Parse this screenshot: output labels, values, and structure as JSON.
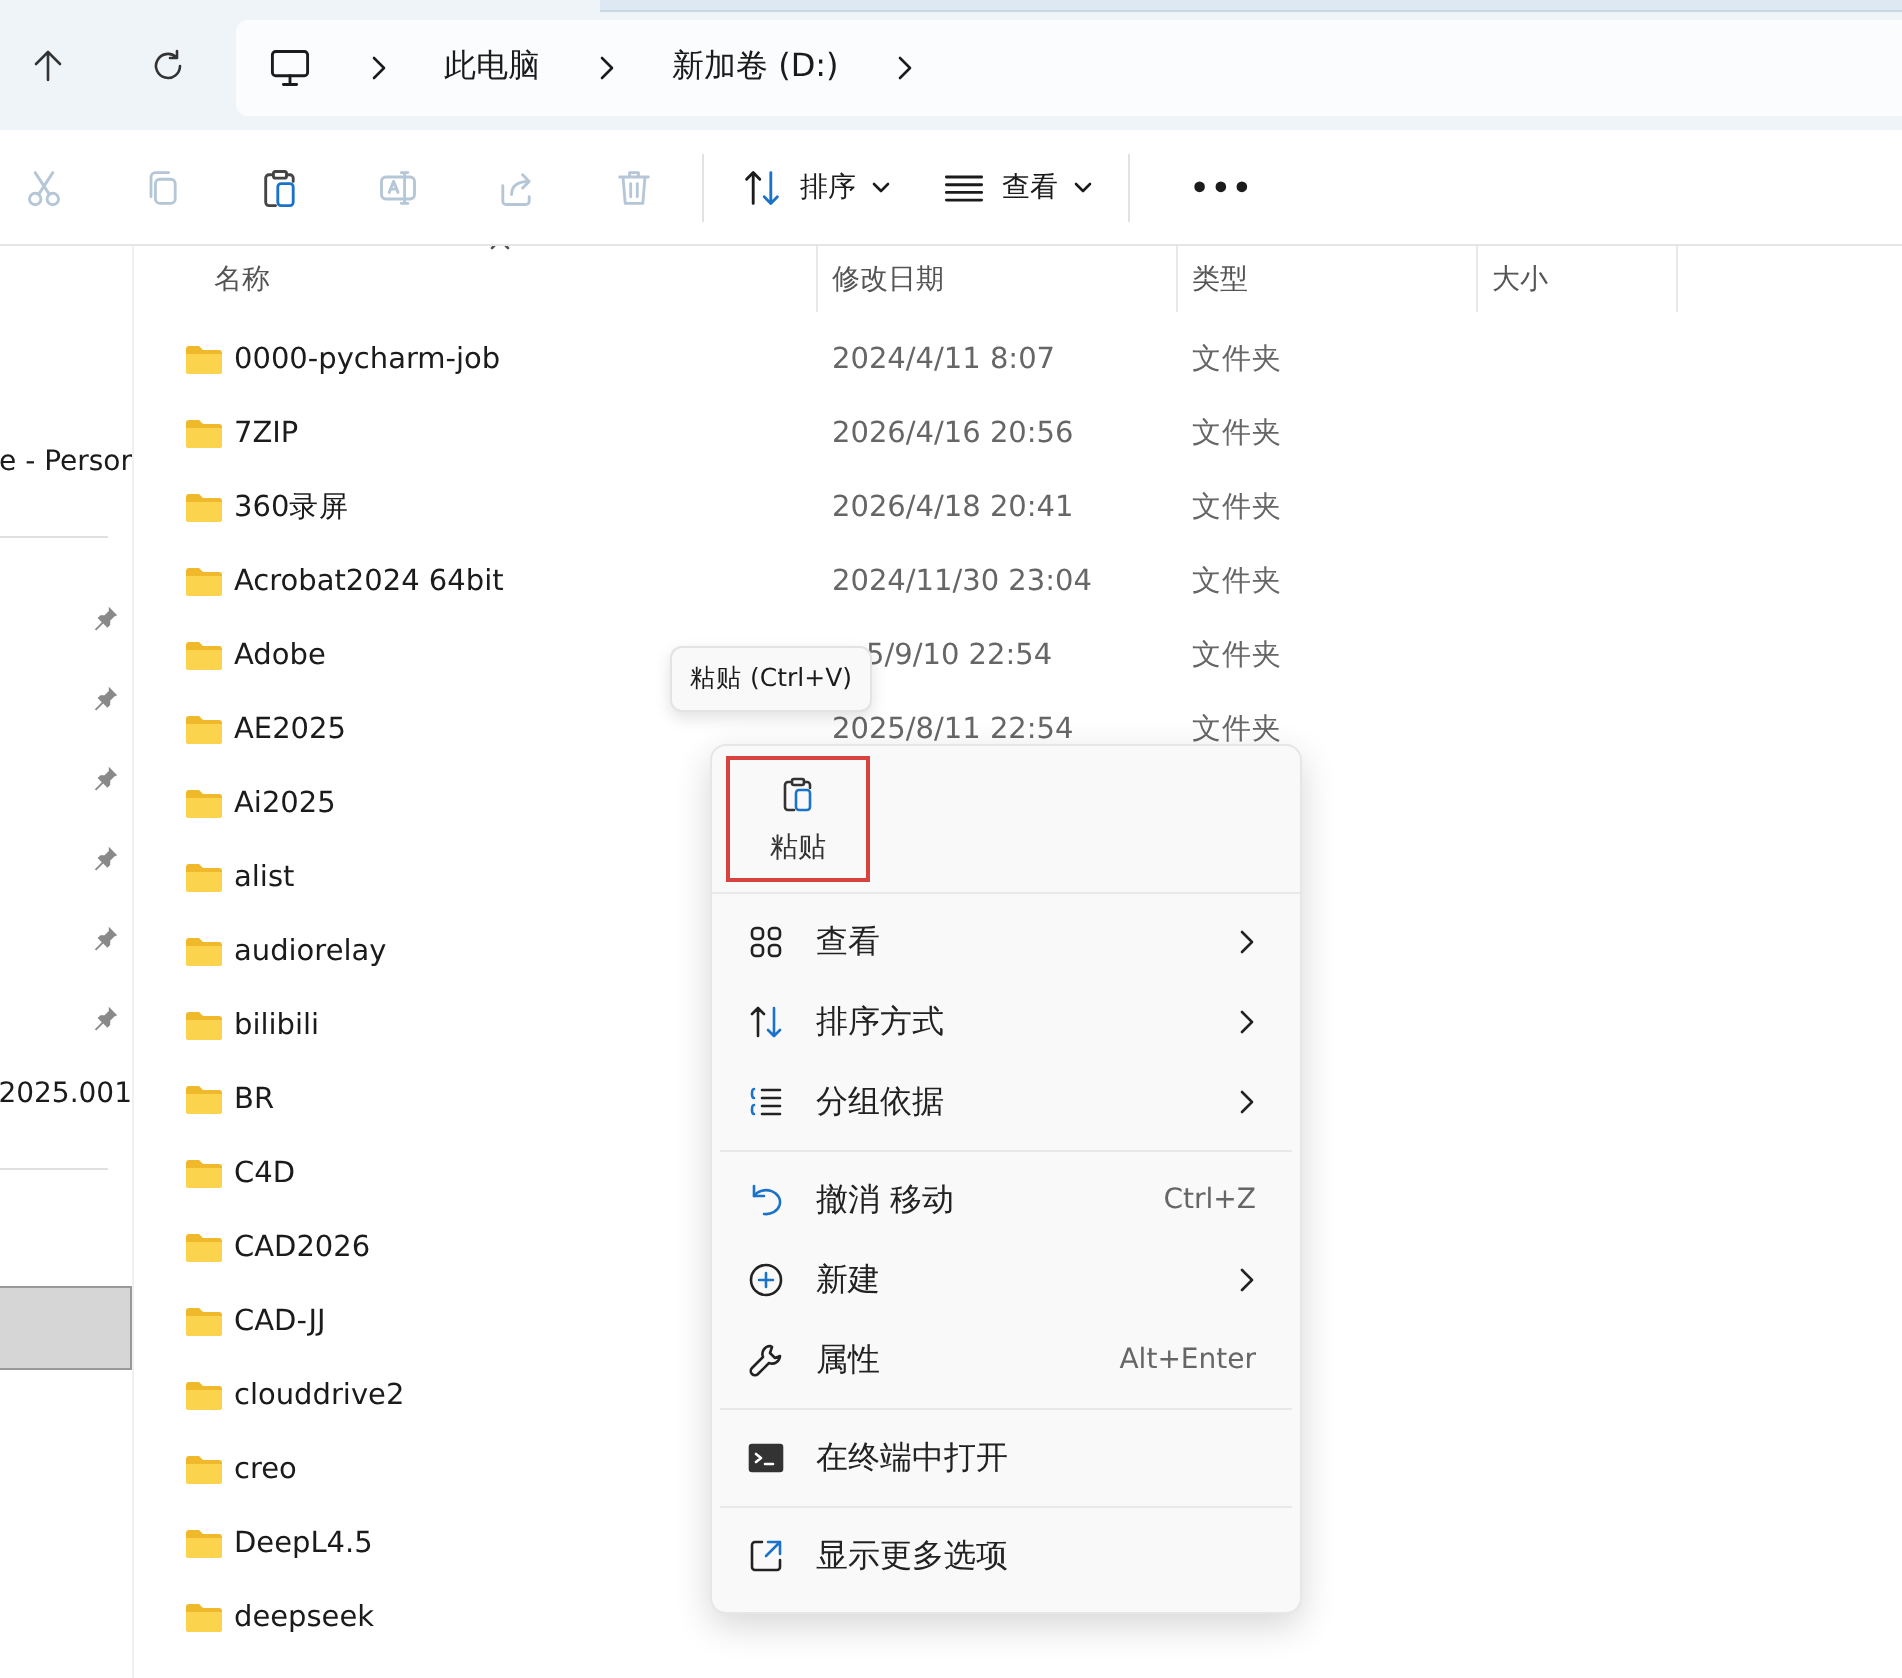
{
  "navigation": {
    "path": [
      {
        "label": "此电脑"
      },
      {
        "label": "新加卷 (D:)"
      }
    ]
  },
  "toolbar": {
    "actions": [
      {
        "kind": "cut",
        "disabled": true
      },
      {
        "kind": "copy",
        "disabled": true
      },
      {
        "kind": "paste",
        "disabled": false
      },
      {
        "kind": "rename",
        "disabled": true
      },
      {
        "kind": "share",
        "disabled": true
      },
      {
        "kind": "delete",
        "disabled": true
      }
    ],
    "sort_label": "排序",
    "view_label": "查看",
    "more": "•••"
  },
  "sidebar": {
    "items": [
      {
        "kind": "text",
        "label": "e - Persor",
        "selected": false
      },
      {
        "kind": "divider"
      },
      {
        "kind": "pinned"
      },
      {
        "kind": "pinned"
      },
      {
        "kind": "pinned"
      },
      {
        "kind": "pinned"
      },
      {
        "kind": "pinned"
      },
      {
        "kind": "pinned"
      },
      {
        "kind": "text",
        "label": "2025.001",
        "selected": false
      },
      {
        "kind": "divider"
      },
      {
        "kind": "blank",
        "selected": true
      }
    ]
  },
  "table": {
    "columns": [
      {
        "label": "名称",
        "sorted": true
      },
      {
        "label": "修改日期",
        "sorted": false
      },
      {
        "label": "类型",
        "sorted": false
      },
      {
        "label": "大小",
        "sorted": false
      }
    ],
    "rows": [
      {
        "name": "0000-pycharm-job",
        "modified": "2024/4/11 8:07",
        "type": "文件夹"
      },
      {
        "name": "7ZIP",
        "modified": "2026/4/16 20:56",
        "type": "文件夹"
      },
      {
        "name": "360录屏",
        "modified": "2026/4/18 20:41",
        "type": "文件夹"
      },
      {
        "name": "Acrobat2024 64bit",
        "modified": "2024/11/30 23:04",
        "type": "文件夹"
      },
      {
        "name": "Adobe",
        "modified": "5/9/10 22:54",
        "type": "文件夹"
      },
      {
        "name": "AE2025",
        "modified": "2025/8/11 22:54",
        "type": "文件夹"
      },
      {
        "name": "Ai2025"
      },
      {
        "name": "alist"
      },
      {
        "name": "audiorelay"
      },
      {
        "name": "bilibili"
      },
      {
        "name": "BR"
      },
      {
        "name": "C4D"
      },
      {
        "name": "CAD2026"
      },
      {
        "name": "CAD-JJ"
      },
      {
        "name": "clouddrive2"
      },
      {
        "name": "creo"
      },
      {
        "name": "DeepL4.5"
      },
      {
        "name": "deepseek"
      }
    ]
  },
  "tooltip": {
    "text": "粘贴 (Ctrl+V)"
  },
  "context_menu": {
    "top_buttons": [
      {
        "kind": "paste",
        "label": "粘贴",
        "highlighted": true
      }
    ],
    "groups": [
      [
        {
          "kind": "view",
          "label": "查看",
          "submenu": true
        },
        {
          "kind": "sort",
          "label": "排序方式",
          "submenu": true
        },
        {
          "kind": "group",
          "label": "分组依据",
          "submenu": true
        }
      ],
      [
        {
          "kind": "undo",
          "label": "撤消 移动",
          "shortcut": "Ctrl+Z",
          "submenu": false
        },
        {
          "kind": "new",
          "label": "新建",
          "submenu": true
        },
        {
          "kind": "properties",
          "label": "属性",
          "shortcut": "Alt+Enter",
          "submenu": false
        }
      ],
      [
        {
          "kind": "terminal",
          "label": "在终端中打开",
          "submenu": false
        }
      ],
      [
        {
          "kind": "more",
          "label": "显示更多选项",
          "submenu": false
        }
      ]
    ]
  }
}
